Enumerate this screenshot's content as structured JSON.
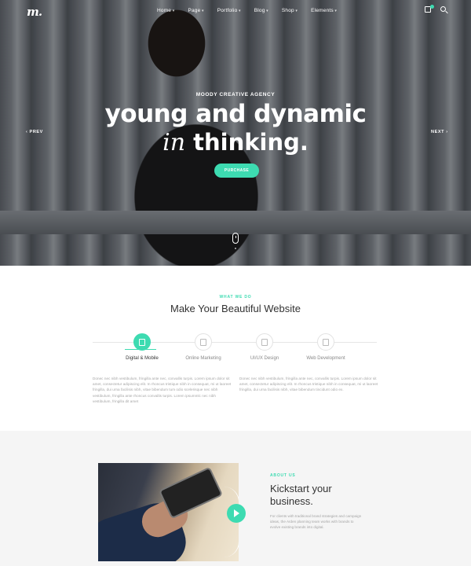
{
  "brand": {
    "logo": "m."
  },
  "nav": {
    "items": [
      "Home",
      "Page",
      "Portfolio",
      "Blog",
      "Shop",
      "Elements"
    ]
  },
  "hero": {
    "eyebrow": "MOODY CREATIVE AGENCY",
    "title_line1": "young and dynamic",
    "title_line2_italic": "in",
    "title_line2_rest": " thinking.",
    "cta": "PURCHASE",
    "prev": "‹ PREV",
    "next": "NEXT ›"
  },
  "services": {
    "eyebrow": "WHAT WE DO",
    "title": "Make Your Beautiful Website",
    "tabs": [
      {
        "label": "Digital & Mobile",
        "icon": "mobile-icon",
        "active": true
      },
      {
        "label": "Online Marketing",
        "icon": "calculator-icon",
        "active": false
      },
      {
        "label": "UI/UX Design",
        "icon": "monitor-icon",
        "active": false
      },
      {
        "label": "Web Development",
        "icon": "browser-icon",
        "active": false
      }
    ],
    "text_left": "Donec nec nibh vestibulum, fringilla ante nec, convallis turpis. Lorem ipsum dolor sit amet, consectetur adipiscing elit. In rhoncus tristique nibh in consequat, mi ut laoreet fringilla, dui urna facilisis nibh, vitae bibendum tum odio scelerisque nec nibh vestibulum, fringilla ante rhoncus convallis turpis. Lorem ipsummlc nec nibh vestibulum, fringilla dit amet",
    "text_right": "Donec nec nibh vestibulum, fringilla ante nec, convallis turpis. Lorem ipsum dolor sit amet, consectetur adipiscing elit. In rhoncus tristique nibh in consequat, mi ut laoreet fringilla, dui urna facilisis nibh, vitae bibendum tincidunt odio ex."
  },
  "about": {
    "eyebrow": "ABOUT US",
    "title": "Kickstart your business.",
    "text": "For clients with traditional brand strategies and campaign ideas, the Arden planning team works with brands to evolve existing brands into digital."
  },
  "colors": {
    "accent": "#3ddbb1"
  }
}
